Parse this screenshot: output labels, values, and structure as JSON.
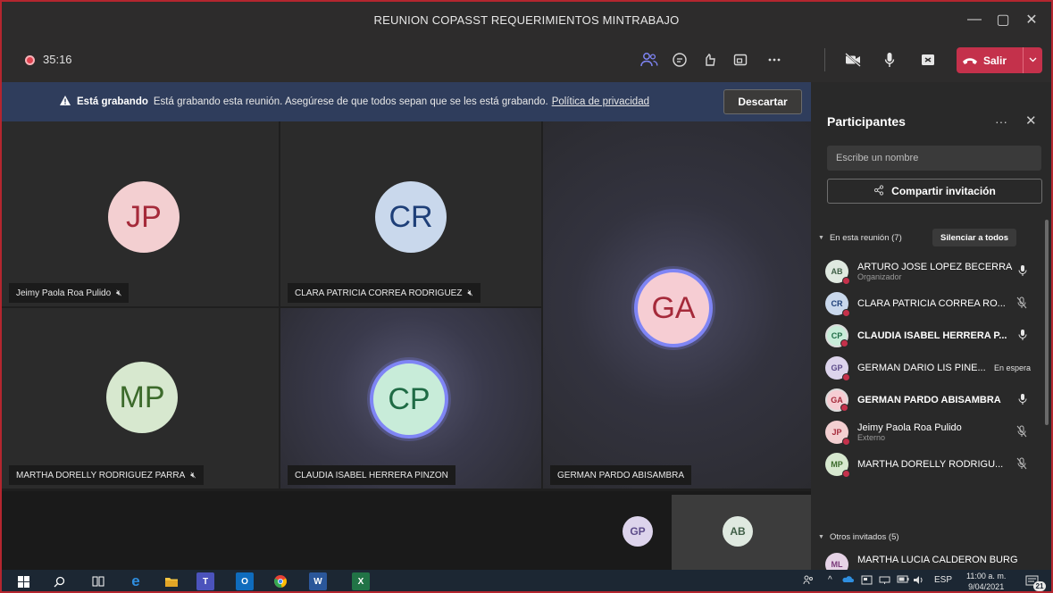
{
  "window": {
    "title": "REUNION COPASST REQUERIMIENTOS MINTRABAJO",
    "controls": {
      "minimize": "—",
      "maximize": "▢",
      "close": "✕"
    }
  },
  "toolbar": {
    "timer": "35:16",
    "leave_label": "Salir",
    "icons": [
      "participants-icon",
      "chat-icon",
      "reactions-icon",
      "rooms-icon",
      "more-icon",
      "camera-off-icon",
      "mic-icon",
      "share-screen-icon",
      "phone-icon"
    ]
  },
  "banner": {
    "bold": "Está grabando",
    "text": "Está grabando esta reunión. Asegúrese de que todos sepan que se les está grabando.",
    "policy_link": "Política de privacidad",
    "dismiss_label": "Descartar"
  },
  "tiles": [
    {
      "initials": "JP",
      "name": "Jeimy Paola Roa Pulido",
      "avatar_bg": "#f3cfd1",
      "text_color": "#a52a3a"
    },
    {
      "initials": "CR",
      "name": "CLARA PATRICIA CORREA RODRIGUEZ",
      "avatar_bg": "#c9d8ec",
      "text_color": "#1e3f78"
    },
    {
      "initials": "GA",
      "name": "GERMAN PARDO ABISAMBRA",
      "avatar_bg": "#f6cdd3",
      "text_color": "#a52a3a"
    },
    {
      "initials": "MP",
      "name": "MARTHA DORELLY RODRIGUEZ PARRA",
      "avatar_bg": "#d7e8cf",
      "text_color": "#3c6a2b"
    },
    {
      "initials": "CP",
      "name": "CLAUDIA ISABEL HERRERA PINZON",
      "avatar_bg": "#c8ecd9",
      "text_color": "#1f6b45"
    }
  ],
  "strip": [
    {
      "initials": "GP",
      "avatar_bg": "#ddd4ec",
      "text_color": "#5d4c8a"
    },
    {
      "initials": "AB",
      "avatar_bg": "#dfe9e0",
      "text_color": "#3f5e46"
    }
  ],
  "panel": {
    "title": "Participantes",
    "more": "···",
    "close": "✕",
    "search_placeholder": "Escribe un nombre",
    "share_label": "Compartir invitación",
    "in_meeting_label": "En esta reunión (7)",
    "mute_all_label": "Silenciar a todos",
    "others_label": "Otros invitados (5)",
    "participants": [
      {
        "initials": "AB",
        "name": "ARTURO JOSE LOPEZ BECERRA",
        "role": "Organizador",
        "avatar_bg": "#dfe9e0",
        "text_color": "#3f5e46",
        "mic": "on"
      },
      {
        "initials": "CR",
        "name": "CLARA PATRICIA CORREA RO...",
        "role": "",
        "avatar_bg": "#c9d8ec",
        "text_color": "#1e3f78",
        "mic": "off"
      },
      {
        "initials": "CP",
        "name": "CLAUDIA ISABEL HERRERA P...",
        "role": "",
        "avatar_bg": "#c8ecd9",
        "text_color": "#1f6b45",
        "mic": "on",
        "speaking": true
      },
      {
        "initials": "GP",
        "name": "GERMAN DARIO LIS PINE...",
        "role": "",
        "avatar_bg": "#ddd4ec",
        "text_color": "#5d4c8a",
        "status": "En espera"
      },
      {
        "initials": "GA",
        "name": "GERMAN PARDO ABISAMBRA",
        "role": "",
        "avatar_bg": "#f6cdd3",
        "text_color": "#a52a3a",
        "mic": "on",
        "speaking": true
      },
      {
        "initials": "JP",
        "name": "Jeimy Paola Roa Pulido",
        "role": "Externo",
        "avatar_bg": "#f3cfd1",
        "text_color": "#a52a3a",
        "mic": "off"
      },
      {
        "initials": "MP",
        "name": "MARTHA DORELLY RODRIGU...",
        "role": "",
        "avatar_bg": "#d7e8cf",
        "text_color": "#3c6a2b",
        "mic": "off"
      }
    ],
    "others": [
      {
        "initials": "ML",
        "name": "MARTHA LUCIA CALDERON BURG...",
        "avatar_bg": "#e6d3e6",
        "text_color": "#7a3a7a"
      }
    ]
  },
  "taskbar": {
    "language": "ESP",
    "time": "11:00 a. m.",
    "date": "9/04/2021",
    "notifications": "21"
  },
  "colors": {
    "accent": "#7f85f5",
    "leave": "#c4314b",
    "banner": "#2f3d5c",
    "frame": "#b4262f"
  }
}
